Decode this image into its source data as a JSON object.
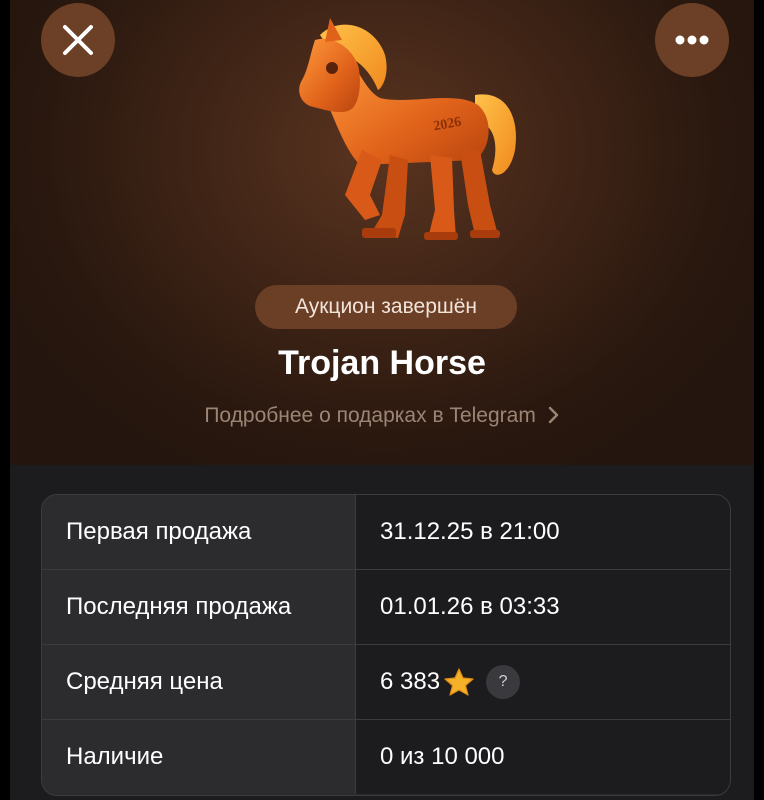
{
  "header": {
    "close_icon": "close-icon",
    "more_icon": "more-dots-icon"
  },
  "gift": {
    "status": "Аукцион завершён",
    "title": "Trojan Horse",
    "engraving": "2026",
    "more_link": "Подробнее о подарках в Telegram",
    "more_link_icon": "chevron-right-icon"
  },
  "info": {
    "rows": [
      {
        "label": "Первая продажа",
        "value": "31.12.25 в 21:00"
      },
      {
        "label": "Последняя продажа",
        "value": "01.01.26 в 03:33"
      },
      {
        "label": "Средняя цена",
        "value": "6 383",
        "icon": "star-icon",
        "help": "?"
      },
      {
        "label": "Наличие",
        "value": "0 из 10 000"
      }
    ]
  },
  "colors": {
    "hero_bg": "#3f2416",
    "pill_bg": "#6a3f26",
    "table_bg": "#1c1c1e",
    "star": "#f5a623"
  }
}
